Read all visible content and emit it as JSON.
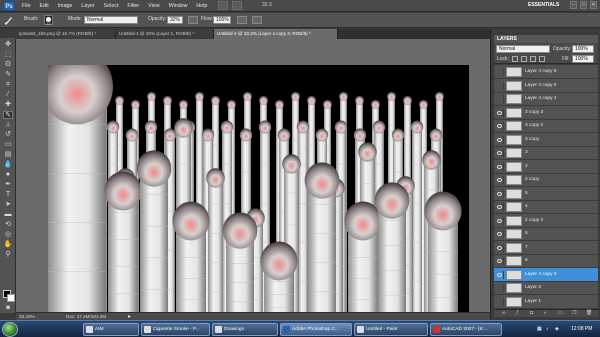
{
  "app": {
    "logo": "Ps",
    "menu": [
      "File",
      "Edit",
      "Image",
      "Layer",
      "Select",
      "Filter",
      "View",
      "Window",
      "Help"
    ],
    "zoom_readout": "33.3",
    "workspace": "ESSENTIALS",
    "window_buttons": [
      "–",
      "□",
      "✕"
    ]
  },
  "options": {
    "brush_label": "Brush:",
    "brush_size": "13",
    "mode_label": "Mode:",
    "mode_value": "Normal",
    "opacity_label": "Opacity:",
    "opacity_value": "32%",
    "flow_label": "Flow:",
    "flow_value": "100%"
  },
  "tabs": [
    "Ipoba63_4b6.png @ 16.7% (RGB/8) *",
    "Untitled-1 @ 25% (Layer 1, RGB/8) *",
    "Untitled-2 @ 33.3% (Layer 4 copy 3, RGB/8) *"
  ],
  "status": {
    "zoom": "33.33%",
    "doc": "Doc: 17.2M/161.2M"
  },
  "layers_panel": {
    "title": "LAYERS",
    "blend_mode": "Normal",
    "opacity_label": "Opacity:",
    "opacity_value": "100%",
    "lock_label": "Lock:",
    "fill_label": "Fill:",
    "fill_value": "100%",
    "items": [
      {
        "name": "Layer 4 copy 9",
        "visible": false,
        "selected": false
      },
      {
        "name": "Layer 4 copy 8",
        "visible": false,
        "selected": false
      },
      {
        "name": "Layer 4 copy 4",
        "visible": false,
        "selected": false
      },
      {
        "name": "3 copy 3",
        "visible": true,
        "selected": false
      },
      {
        "name": "3 copy 2",
        "visible": true,
        "selected": false
      },
      {
        "name": "3 copy",
        "visible": true,
        "selected": false
      },
      {
        "name": "3",
        "visible": true,
        "selected": false
      },
      {
        "name": "2",
        "visible": true,
        "selected": false
      },
      {
        "name": "2 copy",
        "visible": true,
        "selected": false
      },
      {
        "name": "5",
        "visible": true,
        "selected": false
      },
      {
        "name": "4",
        "visible": true,
        "selected": false
      },
      {
        "name": "2 copy 2",
        "visible": true,
        "selected": false
      },
      {
        "name": "6",
        "visible": true,
        "selected": false
      },
      {
        "name": "7",
        "visible": true,
        "selected": false
      },
      {
        "name": "8",
        "visible": true,
        "selected": false
      },
      {
        "name": "Layer 4 copy 3",
        "visible": true,
        "selected": true
      },
      {
        "name": "Layer 2",
        "visible": false,
        "selected": false
      },
      {
        "name": "Layer 1",
        "visible": false,
        "selected": false
      }
    ],
    "footer_icons": [
      "link-icon",
      "fx-icon",
      "mask-icon",
      "adjustment-icon",
      "folder-icon",
      "new-layer-icon",
      "trash-icon"
    ]
  },
  "taskbar": {
    "items": [
      "AIM",
      "Cigarette Smoke - P...",
      "Drawings",
      "Adobe Photoshop C...",
      "Untitled - Paint",
      "AutoCAD 2007 - [6:..."
    ],
    "clock": "12:08 PM"
  },
  "colors": {
    "selected_layer": "#3d8fd9",
    "ui_dark": "#535353",
    "canvas_bg": "#000000"
  }
}
